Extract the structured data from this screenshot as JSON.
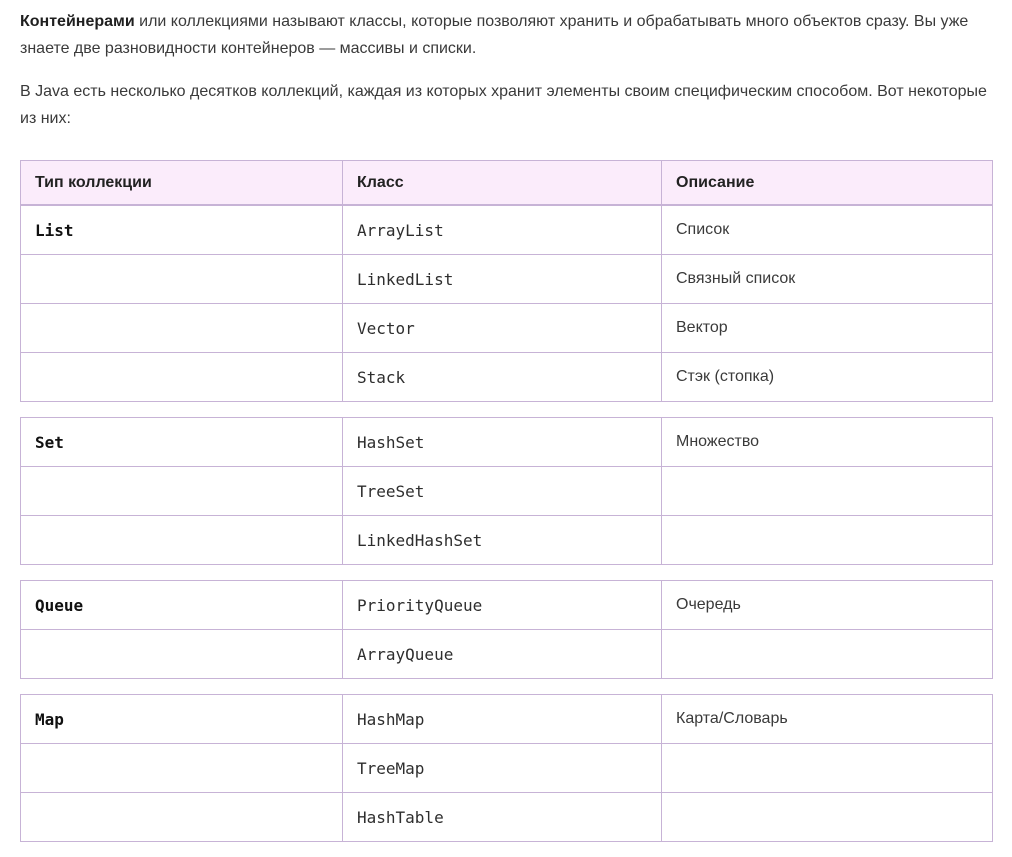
{
  "intro": {
    "bold_term": "Контейнерами",
    "paragraph1_rest": " или коллекциями называют классы, которые позволяют хранить и обрабатывать много объектов сразу. Вы уже знаете две разновидности контейнеров — массивы и списки.",
    "paragraph2": "В Java есть несколько десятков коллекций, каждая из которых хранит элементы своим специфическим способом. Вот некоторые из них:"
  },
  "table": {
    "headers": [
      "Тип коллекции",
      "Класс",
      "Описание"
    ],
    "groups": [
      {
        "type": "List",
        "rows": [
          {
            "class": "ArrayList",
            "description": "Список"
          },
          {
            "class": "LinkedList",
            "description": "Связный список"
          },
          {
            "class": "Vector",
            "description": "Вектор"
          },
          {
            "class": "Stack",
            "description": "Стэк (стопка)"
          }
        ]
      },
      {
        "type": "Set",
        "rows": [
          {
            "class": "HashSet",
            "description": "Множество"
          },
          {
            "class": "TreeSet",
            "description": ""
          },
          {
            "class": "LinkedHashSet",
            "description": ""
          }
        ]
      },
      {
        "type": "Queue",
        "rows": [
          {
            "class": "PriorityQueue",
            "description": "Очередь"
          },
          {
            "class": "ArrayQueue",
            "description": ""
          }
        ]
      },
      {
        "type": "Map",
        "rows": [
          {
            "class": "HashMap",
            "description": "Карта/Словарь"
          },
          {
            "class": "TreeMap",
            "description": ""
          },
          {
            "class": "HashTable",
            "description": ""
          }
        ]
      }
    ]
  },
  "colors": {
    "border": "#c7b3d6",
    "header_bg": "#fbecfb",
    "text": "#3a3a3a"
  }
}
